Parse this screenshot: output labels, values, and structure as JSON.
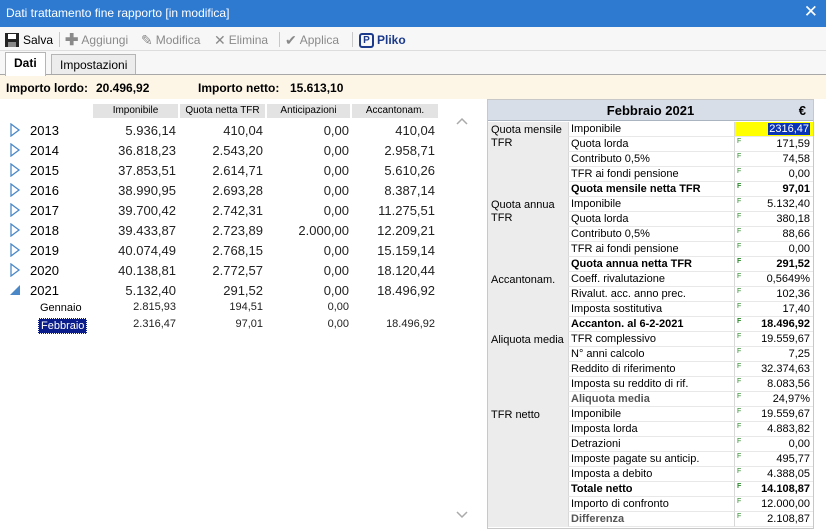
{
  "window": {
    "title": "Dati trattamento fine rapporto [in modifica]"
  },
  "toolbar": {
    "salva": "Salva",
    "aggiungi": "Aggiungi",
    "modifica": "Modifica",
    "elimina": "Elimina",
    "applica": "Applica",
    "pliko": "Pliko"
  },
  "tabs": [
    "Dati",
    "Impostazioni"
  ],
  "importi": {
    "lordo_label": "Importo lordo:",
    "lordo_value": "20.496,92",
    "netto_label": "Importo netto:",
    "netto_value": "15.613,10"
  },
  "columns": [
    "Imponibile",
    "Quota netta TFR",
    "Anticipazioni",
    "Accantonam."
  ],
  "years": [
    {
      "year": "2013",
      "imponibile": "5.936,14",
      "quota": "410,04",
      "anticip": "0,00",
      "accant": "410,04"
    },
    {
      "year": "2014",
      "imponibile": "36.818,23",
      "quota": "2.543,20",
      "anticip": "0,00",
      "accant": "2.958,71"
    },
    {
      "year": "2015",
      "imponibile": "37.853,51",
      "quota": "2.614,71",
      "anticip": "0,00",
      "accant": "5.610,26"
    },
    {
      "year": "2016",
      "imponibile": "38.990,95",
      "quota": "2.693,28",
      "anticip": "0,00",
      "accant": "8.387,14"
    },
    {
      "year": "2017",
      "imponibile": "39.700,42",
      "quota": "2.742,31",
      "anticip": "0,00",
      "accant": "11.275,51"
    },
    {
      "year": "2018",
      "imponibile": "39.433,87",
      "quota": "2.723,89",
      "anticip": "2.000,00",
      "accant": "12.209,21"
    },
    {
      "year": "2019",
      "imponibile": "40.074,49",
      "quota": "2.768,15",
      "anticip": "0,00",
      "accant": "15.159,14"
    },
    {
      "year": "2020",
      "imponibile": "40.138,81",
      "quota": "2.772,57",
      "anticip": "0,00",
      "accant": "18.120,44"
    },
    {
      "year": "2021",
      "imponibile": "5.132,40",
      "quota": "291,52",
      "anticip": "0,00",
      "accant": "18.496,92"
    }
  ],
  "months": [
    {
      "name": "Gennaio",
      "imponibile": "2.815,93",
      "quota": "194,51",
      "anticip": "0,00",
      "accant": ""
    },
    {
      "name": "Febbraio",
      "imponibile": "2.316,47",
      "quota": "97,01",
      "anticip": "0,00",
      "accant": "18.496,92"
    }
  ],
  "detail": {
    "month": "Febbraio 2021",
    "currency": "€",
    "sections": [
      {
        "label": "Quota mensile TFR",
        "rows": [
          {
            "label": "Imponibile",
            "value": "2316,47"
          },
          {
            "label": "Quota lorda",
            "value": "171,59"
          },
          {
            "label": "Contributo 0,5%",
            "value": "74,58"
          },
          {
            "label": "TFR ai fondi pensione",
            "value": "0,00"
          },
          {
            "label": "Quota mensile netta TFR",
            "value": "97,01"
          }
        ]
      },
      {
        "label": "Quota annua TFR",
        "rows": [
          {
            "label": "Imponibile",
            "value": "5.132,40"
          },
          {
            "label": "Quota lorda",
            "value": "380,18"
          },
          {
            "label": "Contributo 0,5%",
            "value": "88,66"
          },
          {
            "label": "TFR ai fondi pensione",
            "value": "0,00"
          },
          {
            "label": "Quota annua netta TFR",
            "value": "291,52"
          }
        ]
      },
      {
        "label": "Accantonam.",
        "rows": [
          {
            "label": "Coeff. rivalutazione",
            "value": "0,5649%"
          },
          {
            "label": "Rivalut. acc. anno prec.",
            "value": "102,36"
          },
          {
            "label": "Imposta sostitutiva",
            "value": "17,40"
          },
          {
            "label": "Accanton. al 6-2-2021",
            "value": "18.496,92"
          }
        ]
      },
      {
        "label": "Aliquota media",
        "rows": [
          {
            "label": "TFR complessivo",
            "value": "19.559,67"
          },
          {
            "label": "N° anni calcolo",
            "value": "7,25"
          },
          {
            "label": "Reddito di riferimento",
            "value": "32.374,63"
          },
          {
            "label": "Imposta su reddito di rif.",
            "value": "8.083,56"
          },
          {
            "label": "Aliquota media",
            "value": "24,97%"
          }
        ]
      },
      {
        "label": "TFR netto",
        "rows": [
          {
            "label": "Imponibile",
            "value": "19.559,67"
          },
          {
            "label": "Imposta lorda",
            "value": "4.883,82"
          },
          {
            "label": "Detrazioni",
            "value": "0,00"
          },
          {
            "label": "Imposte pagate su anticip.",
            "value": "495,77"
          },
          {
            "label": "Imposta a debito",
            "value": "4.388,05"
          },
          {
            "label": "Totale netto",
            "value": "14.108,87"
          },
          {
            "label": "Importo di confronto",
            "value": "12.000,00"
          },
          {
            "label": "Differenza",
            "value": "2.108,87"
          }
        ]
      }
    ]
  }
}
